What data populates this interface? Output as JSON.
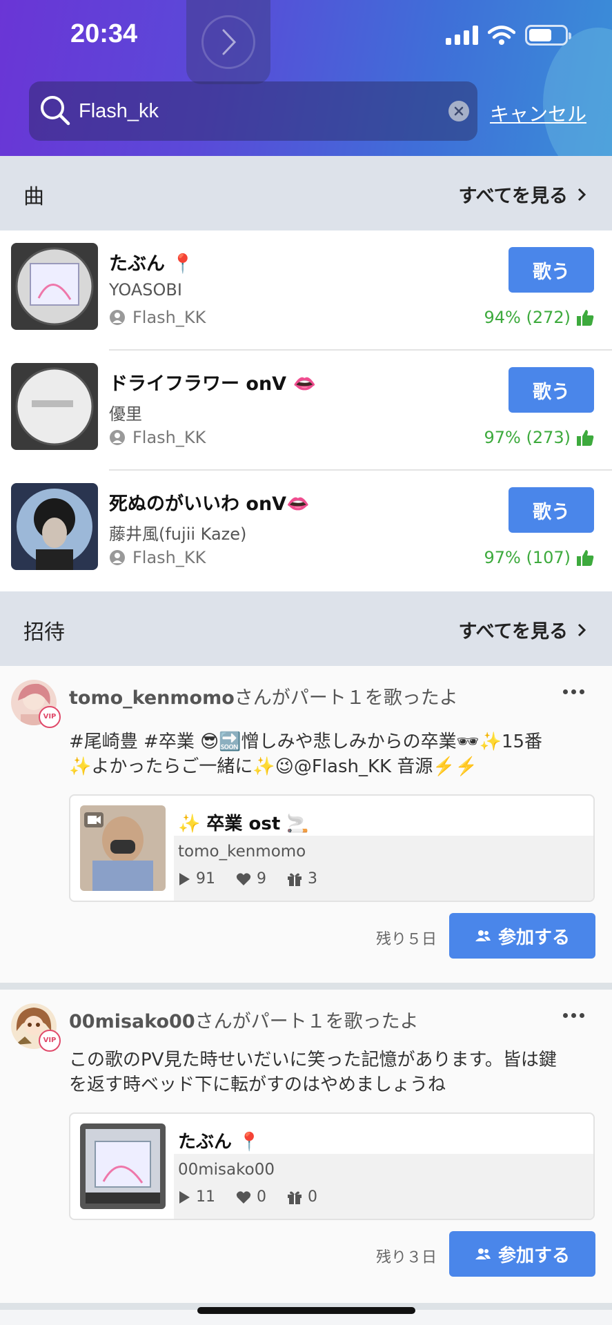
{
  "status": {
    "time": "20:34"
  },
  "search": {
    "query": "Flash_kk",
    "cancel": "キャンセル"
  },
  "songs_section": {
    "title": "曲",
    "see_all": "すべてを見る"
  },
  "songs": [
    {
      "title": "たぶん 📍",
      "artist": "YOASOBI",
      "owner": "Flash_KK",
      "sing": "歌う",
      "rating": "94% (272)"
    },
    {
      "title": "ドライフラワー onV 👄",
      "artist": "優里",
      "owner": "Flash_KK",
      "sing": "歌う",
      "rating": "97% (273)"
    },
    {
      "title": "死ぬのがいいわ onV👄",
      "artist": "藤井風(fujii Kaze)",
      "owner": "Flash_KK",
      "sing": "歌う",
      "rating": "97% (107)"
    }
  ],
  "invites_section": {
    "title": "招待",
    "see_all": "すべてを見る"
  },
  "posts": [
    {
      "username": "tomo_kenmomo",
      "action": "さんがパート１を歌ったよ",
      "badge": "VIP",
      "text_line1": "#尾崎豊 #卒業 😎🔜憎しみや悲しみからの卒業🕶✨15番",
      "text_line2": "✨よかったらご一緒に✨😉@Flash_KK 音源⚡️⚡️",
      "card": {
        "title": "✨ 卒業 ost 🚬",
        "user": "tomo_kenmomo",
        "plays": "91",
        "likes": "9",
        "gifts": "3"
      },
      "remaining": "残り５日",
      "join": "参加する"
    },
    {
      "username": "00misako00",
      "action": "さんがパート１を歌ったよ",
      "badge": "VIP",
      "text_line1": "この歌のPV見た時せいだいに笑った記憶があります。皆は鍵",
      "text_line2": "を返す時ベッド下に転がすのはやめましょうね",
      "card": {
        "title": "たぶん 📍",
        "user": "00misako00",
        "plays": "11",
        "likes": "0",
        "gifts": "0"
      },
      "remaining": "残り３日",
      "join": "参加する"
    }
  ],
  "colors": {
    "accent": "#4a86ea",
    "rating": "#3daa3d",
    "section_bg": "#dde2ea"
  }
}
